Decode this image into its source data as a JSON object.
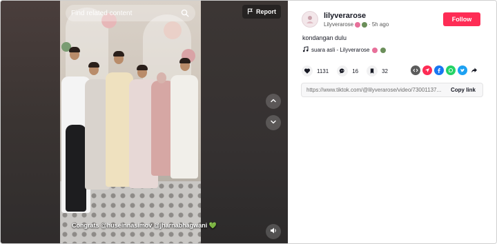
{
  "player": {
    "search_placeholder": "Find related content",
    "report_label": "Report",
    "caption_text": "Congrats @huseinnasimov @jharnabhagwani",
    "caption_emoji": "💚"
  },
  "author": {
    "username": "lilyverarose",
    "display_name": "Lilyverarose",
    "separator": "·",
    "time_ago": "5h ago",
    "follow_label": "Follow"
  },
  "post": {
    "description": "kondangan dulu",
    "music": "suara asli - Lilyverarose"
  },
  "stats": {
    "likes": "1131",
    "comments": "16",
    "saves": "32"
  },
  "share": {
    "icons": [
      "embed-icon",
      "send-icon",
      "facebook-icon",
      "whatsapp-icon",
      "twitter-icon",
      "share-arrow-icon"
    ]
  },
  "link": {
    "url": "https://www.tiktok.com/@lilyverarose/video/73001137...",
    "copy_label": "Copy link"
  },
  "colors": {
    "follow": "#fe2c55",
    "player_bg": "#3a3636",
    "share_embed": "#5c5c5c",
    "share_send": "#fe2c55",
    "share_facebook": "#1877f2",
    "share_whatsapp": "#25d366",
    "share_twitter": "#1da1f2"
  }
}
